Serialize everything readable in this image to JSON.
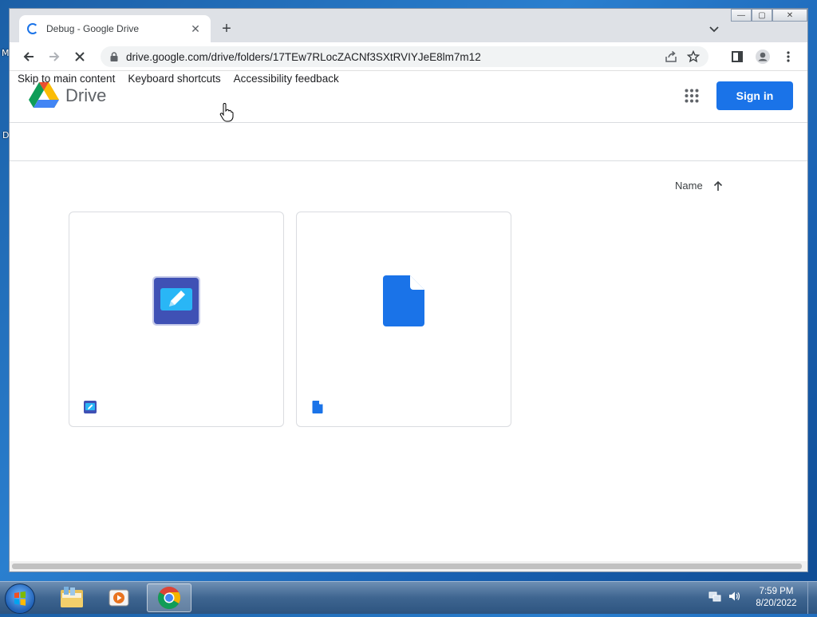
{
  "desktop": {
    "edge_label_top": "M",
    "edge_label_mid": "D"
  },
  "browser": {
    "tab_title": "Debug - Google Drive",
    "tab_close": "✕",
    "new_tab": "+",
    "url": "drive.google.com/drive/folders/17TEw7RLocZACNf3SXtRVIYJeE8lm7m12",
    "window_controls": {
      "minimize": "—",
      "maximize": "▢",
      "close": "✕"
    }
  },
  "page": {
    "skip_links": [
      "Skip to main content",
      "Keyboard shortcuts",
      "Accessibility feedback"
    ],
    "drive_name": "Drive",
    "signin_label": "Sign in",
    "sort_label": "Name",
    "files": [
      {
        "type": "drawing",
        "icon": "drawing-icon",
        "color": "#3f51b5"
      },
      {
        "type": "document",
        "icon": "file-icon",
        "color": "#1a73e8"
      }
    ]
  },
  "taskbar": {
    "time": "7:59 PM",
    "date": "8/20/2022"
  },
  "colors": {
    "accent": "#1a73e8",
    "drawing": "#3f51b5"
  }
}
